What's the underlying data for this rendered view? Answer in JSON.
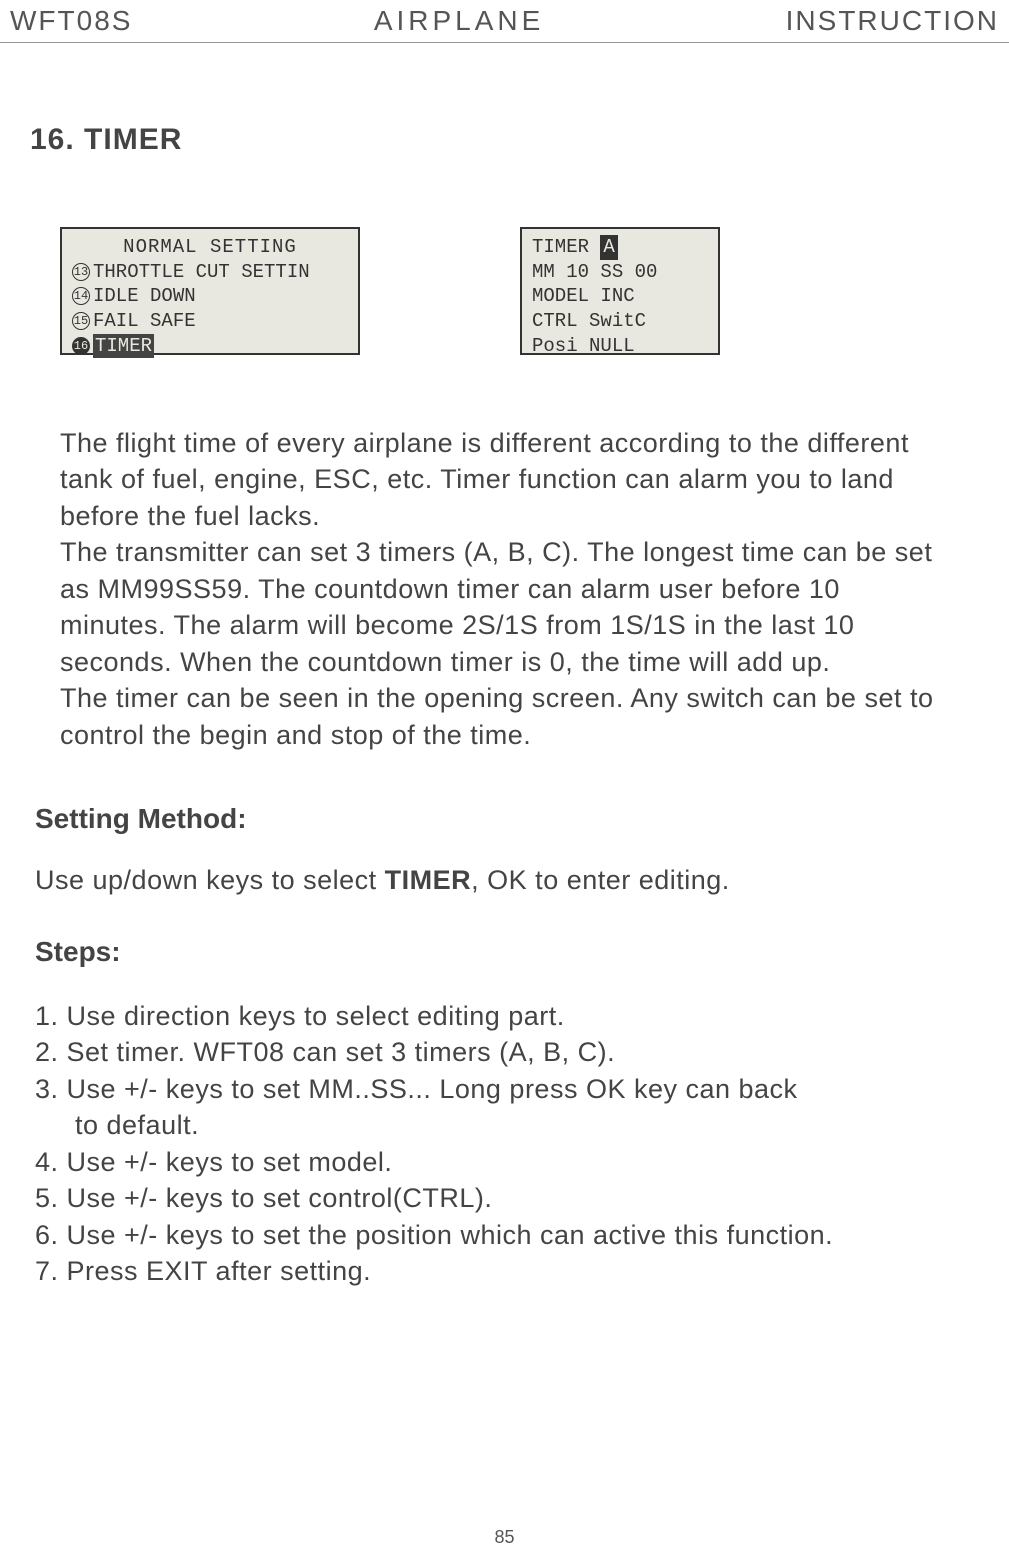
{
  "header": {
    "left": "WFT08S",
    "center": "AIRPLANE",
    "right": "INSTRUCTION"
  },
  "section_title": "16. TIMER",
  "screen1": {
    "title": "NORMAL SETTING",
    "item13_num": "13",
    "item13": "THROTTLE CUT SETTIN",
    "item14_num": "14",
    "item14": "IDLE DOWN",
    "item15_num": "15",
    "item15": "FAIL SAFE",
    "item16_num": "16",
    "item16": "TIMER"
  },
  "screen2": {
    "line1_label": "TIMER ",
    "line1_val": "A",
    "line2": "MM 10 SS 00",
    "line3": "MODEL  INC",
    "line4": "CTRL SwitC",
    "line5": "Posi NULL"
  },
  "body": {
    "p1": "The flight time of every airplane is different according to the different tank of fuel, engine, ESC, etc. Timer function can alarm you to land before the fuel lacks.",
    "p2": "The transmitter can set 3 timers (A, B, C). The longest time can be set as MM99SS59. The countdown timer can alarm user before 10 minutes. The alarm will become 2S/1S from 1S/1S  in the last 10 seconds. When the countdown timer is 0, the time will add up.",
    "p3": "The timer can be seen in the opening screen. Any switch can be set to control the begin and stop of the time."
  },
  "method": {
    "title": "Setting Method:",
    "text_before": "Use up/down keys to select ",
    "text_bold": "TIMER",
    "text_after": ", OK to enter editing."
  },
  "steps": {
    "title": "Steps:",
    "s1": "1. Use direction keys to select editing part.",
    "s2": "2. Set timer. WFT08 can set 3 timers (A, B, C).",
    "s3a": "3. Use +/- keys to set MM..SS... Long press OK key can back",
    "s3b": "to default.",
    "s4": "4. Use +/- keys to set model.",
    "s5": "5. Use +/- keys to set control(CTRL).",
    "s6": "6. Use +/- keys to set the position which can  active this  function.",
    "s7": "7. Press EXIT after setting."
  },
  "page_number": "85"
}
